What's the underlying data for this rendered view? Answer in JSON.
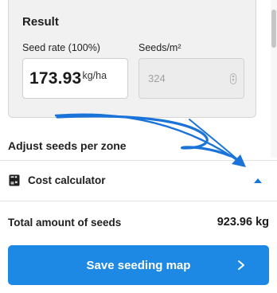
{
  "result": {
    "title": "Result",
    "seed_rate_label": "Seed rate (100%)",
    "seed_rate_value": "173.93",
    "seed_rate_unit": "kg/ha",
    "seeds_label": "Seeds/m²",
    "seeds_value": "324"
  },
  "adjust_section": {
    "heading": "Adjust seeds per zone"
  },
  "cost_calculator": {
    "label": "Cost calculator",
    "icon": "calculator-icon",
    "expanded_state_icon": "caret-up-icon"
  },
  "summary": {
    "total_label": "Total amount of seeds",
    "total_value": "923.96 kg"
  },
  "actions": {
    "save_label": "Save seeding map",
    "save_icon": "chevron-right-icon"
  },
  "colors": {
    "primary": "#1e88e5",
    "annotation_arrow": "#1a73d9"
  }
}
